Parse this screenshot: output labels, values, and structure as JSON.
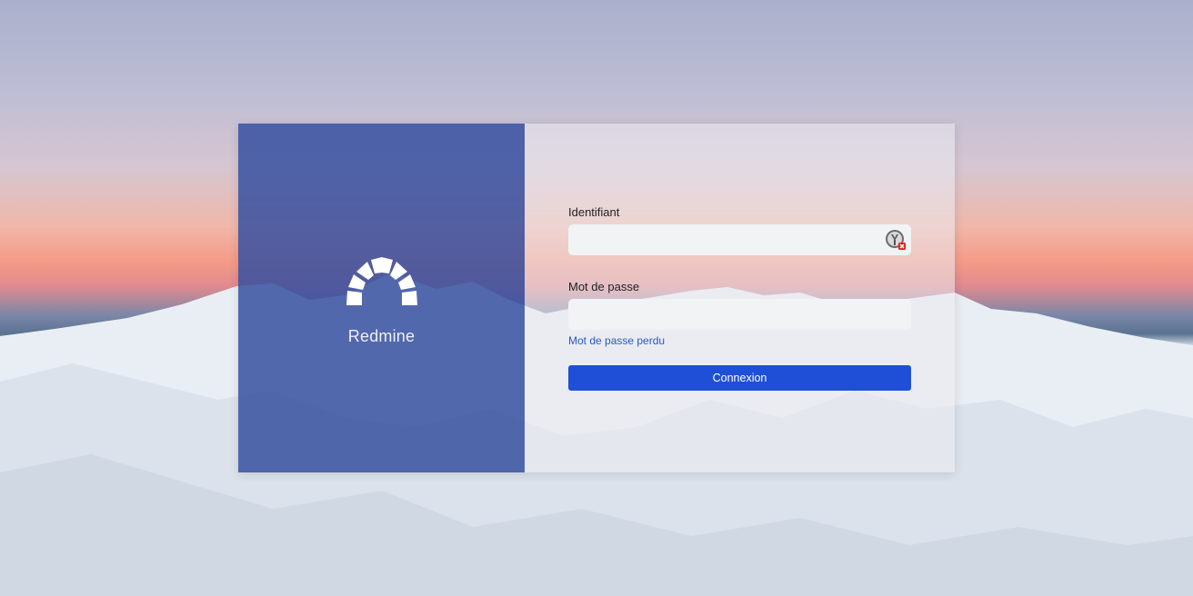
{
  "brand": {
    "name": "Redmine",
    "logo_icon": "redmine-arch-icon"
  },
  "login": {
    "username_label": "Identifiant",
    "username_value": "",
    "password_label": "Mot de passe",
    "password_value": "",
    "lost_password_link": "Mot de passe perdu",
    "submit_label": "Connexion",
    "password_manager_icon": "password-manager-icon"
  },
  "colors": {
    "brand_panel": "#3750a0",
    "primary_button": "#1f4fd6",
    "link": "#2a56c6"
  }
}
